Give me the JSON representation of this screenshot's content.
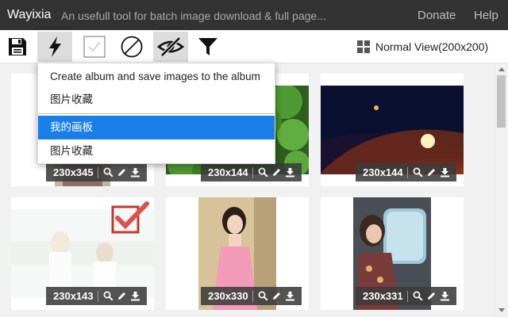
{
  "header": {
    "brand": "Wayixia",
    "tagline": "An usefull tool for batch image download & full page...",
    "donate_label": "Donate",
    "help_label": "Help"
  },
  "toolbar": {
    "buttons": [
      {
        "name": "save",
        "icon": "floppy-disk-icon"
      },
      {
        "name": "quick-action",
        "icon": "lightning-bolt-icon",
        "active": true
      },
      {
        "name": "select-all",
        "icon": "checkbox-icon"
      },
      {
        "name": "deselect-all",
        "icon": "prohibited-icon"
      },
      {
        "name": "hide-selected",
        "icon": "eye-slash-icon",
        "active": true
      },
      {
        "name": "filter",
        "icon": "funnel-icon"
      }
    ],
    "view_label": "Normal View(200x200)",
    "view_icon": "grid-icon"
  },
  "dropdown": {
    "items": [
      {
        "label": "Create album and save images to the album",
        "selected": false
      },
      {
        "label": "图片收藏",
        "selected": false
      },
      {
        "label": "我的画板",
        "selected": true
      },
      {
        "label": "图片收藏",
        "selected": false
      }
    ]
  },
  "images": [
    {
      "size": "230x345",
      "subject": "portrait photo"
    },
    {
      "size": "230x144",
      "subject": "green clover leaves"
    },
    {
      "size": "230x144",
      "subject": "planet sunrise in space"
    },
    {
      "size": "230x143",
      "subject": "two women in white outdoors",
      "checked": true
    },
    {
      "size": "230x330",
      "subject": "woman in pink dress"
    },
    {
      "size": "230x331",
      "subject": "woman by train window"
    }
  ],
  "bar_icons": [
    "search-icon",
    "pencil-icon",
    "download-icon"
  ],
  "colors": {
    "header_bg": "#333333",
    "selected_item": "#1a7fe8",
    "checkmark": "#d9534f",
    "info_bar": "#3c3c3c"
  }
}
